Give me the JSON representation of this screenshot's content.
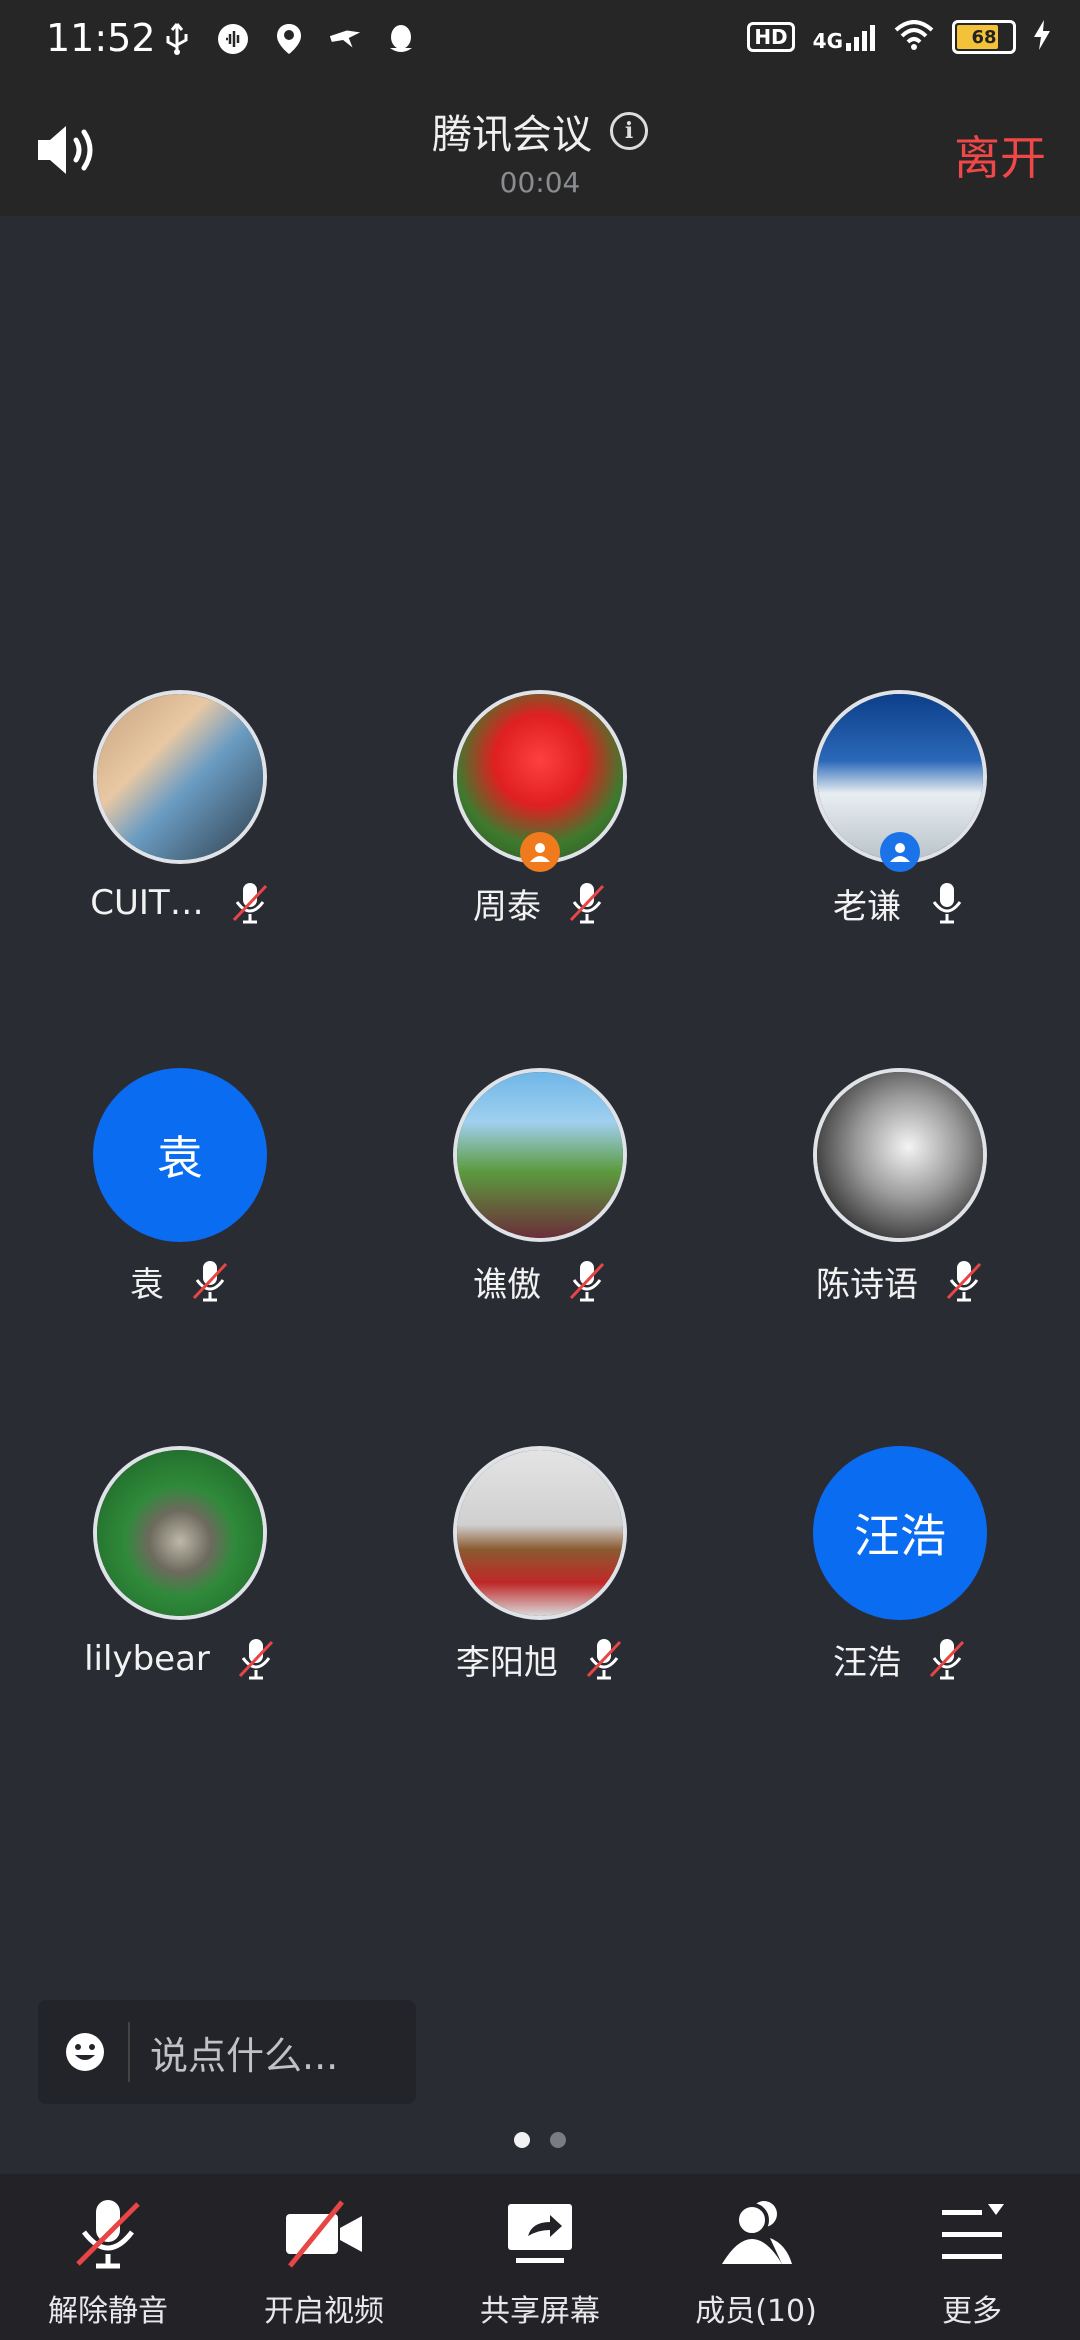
{
  "status_bar": {
    "time": "11:52",
    "network": "4G",
    "battery": "68"
  },
  "header": {
    "title": "腾讯会议",
    "timer": "00:04",
    "leave": "离开"
  },
  "participants": [
    {
      "name": "CUIT…",
      "avatar_text": "",
      "muted": true,
      "badge": ""
    },
    {
      "name": "周泰",
      "avatar_text": "",
      "muted": true,
      "badge": "host"
    },
    {
      "name": "老谦",
      "avatar_text": "",
      "muted": false,
      "badge": "cohost"
    },
    {
      "name": "袁",
      "avatar_text": "袁",
      "muted": true,
      "badge": ""
    },
    {
      "name": "谯傲",
      "avatar_text": "",
      "muted": true,
      "badge": ""
    },
    {
      "name": "陈诗语",
      "avatar_text": "",
      "muted": true,
      "badge": ""
    },
    {
      "name": "lilybear",
      "avatar_text": "",
      "muted": true,
      "badge": ""
    },
    {
      "name": "李阳旭",
      "avatar_text": "",
      "muted": true,
      "badge": ""
    },
    {
      "name": "汪浩",
      "avatar_text": "汪浩",
      "muted": true,
      "badge": ""
    }
  ],
  "chat": {
    "placeholder": "说点什么..."
  },
  "pagination": {
    "current": 1,
    "total": 2
  },
  "toolbar": {
    "unmute": "解除静音",
    "video": "开启视频",
    "share": "共享屏幕",
    "members": "成员(10)",
    "more": "更多"
  },
  "colors": {
    "accent": "#0a6cf0",
    "leave": "#f04848",
    "host_badge": "#f07b1e",
    "cohost_badge": "#1a73e8"
  }
}
